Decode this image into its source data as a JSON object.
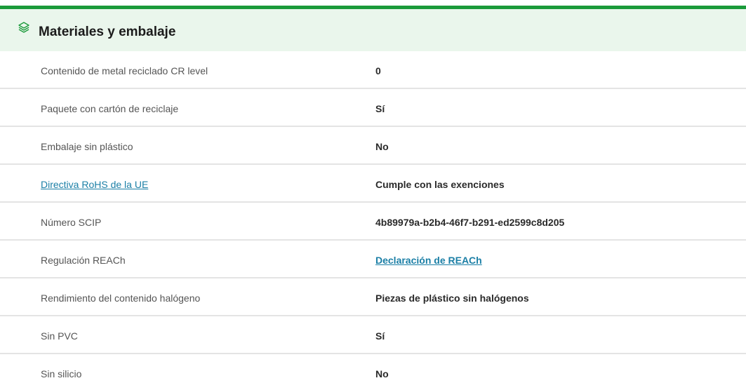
{
  "section": {
    "title": "Materiales y embalaje",
    "icon": "layers-icon",
    "accent_color": "#1a9a3a",
    "header_bg": "#eaf6ec",
    "link_color": "#1b7fa6"
  },
  "rows": [
    {
      "label": "Contenido de metal reciclado CR level",
      "value": "0"
    },
    {
      "label": "Paquete con cartón de reciclaje",
      "value": "Sí"
    },
    {
      "label": "Embalaje sin plástico",
      "value": "No"
    },
    {
      "label": "Directiva RoHS de la UE",
      "value": "Cumple con las exenciones"
    },
    {
      "label": "Número SCIP",
      "value": "4b89979a-b2b4-46f7-b291-ed2599c8d205"
    },
    {
      "label": "Regulación REACh",
      "value": "Declaración de REACh"
    },
    {
      "label": "Rendimiento del contenido halógeno",
      "value": "Piezas de plástico sin halógenos"
    },
    {
      "label": "Sin PVC",
      "value": "Sí"
    },
    {
      "label": "Sin silicio",
      "value": "No"
    }
  ]
}
